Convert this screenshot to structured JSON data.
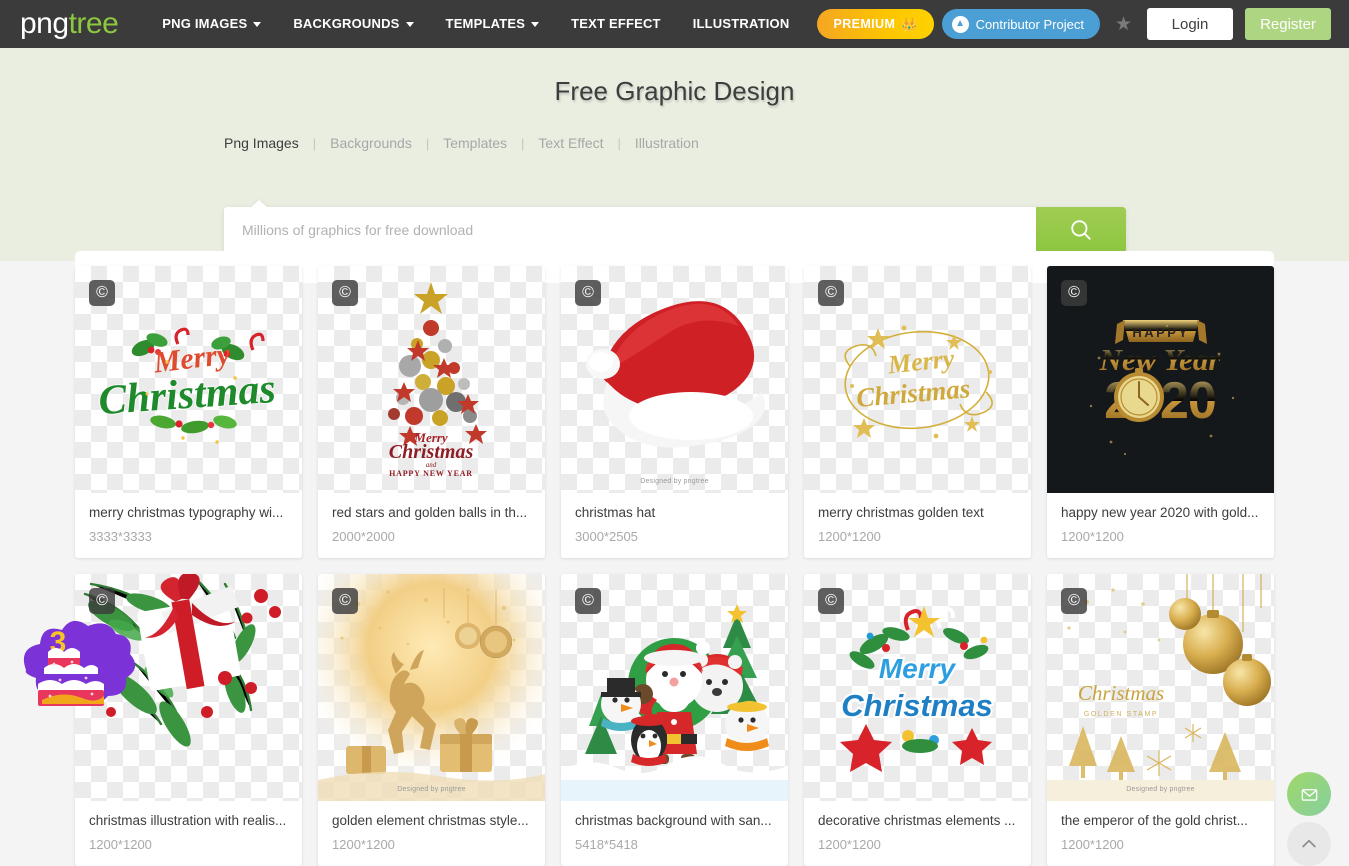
{
  "navbar": {
    "logo_png": "png",
    "logo_tree": "tree",
    "links": [
      {
        "label": "PNG IMAGES",
        "caret": true
      },
      {
        "label": "BACKGROUNDS",
        "caret": true
      },
      {
        "label": "TEMPLATES",
        "caret": true
      },
      {
        "label": "TEXT EFFECT",
        "caret": false
      },
      {
        "label": "ILLUSTRATION",
        "caret": false
      }
    ],
    "premium_label": "PREMIUM",
    "crown_icon": "crown-icon",
    "contributor_label": "Contributor Project",
    "cloud_icon": "cloud-upload-icon",
    "star_icon": "star-icon",
    "login_label": "Login",
    "register_label": "Register",
    "colors": {
      "bar": "#3b3b3b",
      "logo_accent": "#8dc63f",
      "premium_start": "#f5a623",
      "premium_end": "#ffd200",
      "contributor": "#4b9fd5",
      "register": "#aed581"
    }
  },
  "hero": {
    "title": "Free Graphic Design",
    "tabs": [
      {
        "label": "Png Images",
        "active": true
      },
      {
        "label": "Backgrounds",
        "active": false
      },
      {
        "label": "Templates",
        "active": false
      },
      {
        "label": "Text Effect",
        "active": false
      },
      {
        "label": "Illustration",
        "active": false
      }
    ],
    "separator": "|",
    "search_placeholder": "Millions of graphics for free download",
    "search_value": "",
    "search_icon": "search-icon",
    "background_color": "#eaeee1"
  },
  "results": {
    "cards": [
      {
        "title": "merry christmas typography wi...",
        "dims": "3333*3333",
        "art": "merry-christmas-green",
        "dark": false,
        "watermark": ""
      },
      {
        "title": "red stars and golden balls in th...",
        "dims": "2000*2000",
        "art": "ornament-tree",
        "dark": false,
        "watermark": ""
      },
      {
        "title": "christmas hat",
        "dims": "3000*2505",
        "art": "santa-hat",
        "dark": false,
        "watermark": "Designed by pngtree"
      },
      {
        "title": "merry christmas golden text",
        "dims": "1200*1200",
        "art": "golden-script",
        "dark": false,
        "watermark": ""
      },
      {
        "title": "happy new year 2020 with gold...",
        "dims": "1200*1200",
        "art": "new-year-2020",
        "dark": true,
        "watermark": ""
      },
      {
        "title": "christmas illustration with realis...",
        "dims": "1200*1200",
        "art": "gift-pine",
        "dark": false,
        "watermark": ""
      },
      {
        "title": "golden element christmas style...",
        "dims": "1200*1200",
        "art": "golden-deer",
        "dark": false,
        "watermark": "Designed by pngtree"
      },
      {
        "title": "christmas background with san...",
        "dims": "5418*5418",
        "art": "santa-friends",
        "dark": false,
        "watermark": ""
      },
      {
        "title": "decorative christmas elements ...",
        "dims": "1200*1200",
        "art": "merry-christmas-blue",
        "dark": false,
        "watermark": ""
      },
      {
        "title": "the emperor of the gold christ...",
        "dims": "1200*1200",
        "art": "gold-baubles",
        "dark": false,
        "watermark": "Designed by pngtree"
      }
    ],
    "copyright_badge": "©"
  },
  "floating": {
    "cake_sticker": "birthday-cake-sticker",
    "cake_number": "3",
    "mail_icon": "envelope-icon",
    "top_icon": "chevron-up-icon"
  }
}
